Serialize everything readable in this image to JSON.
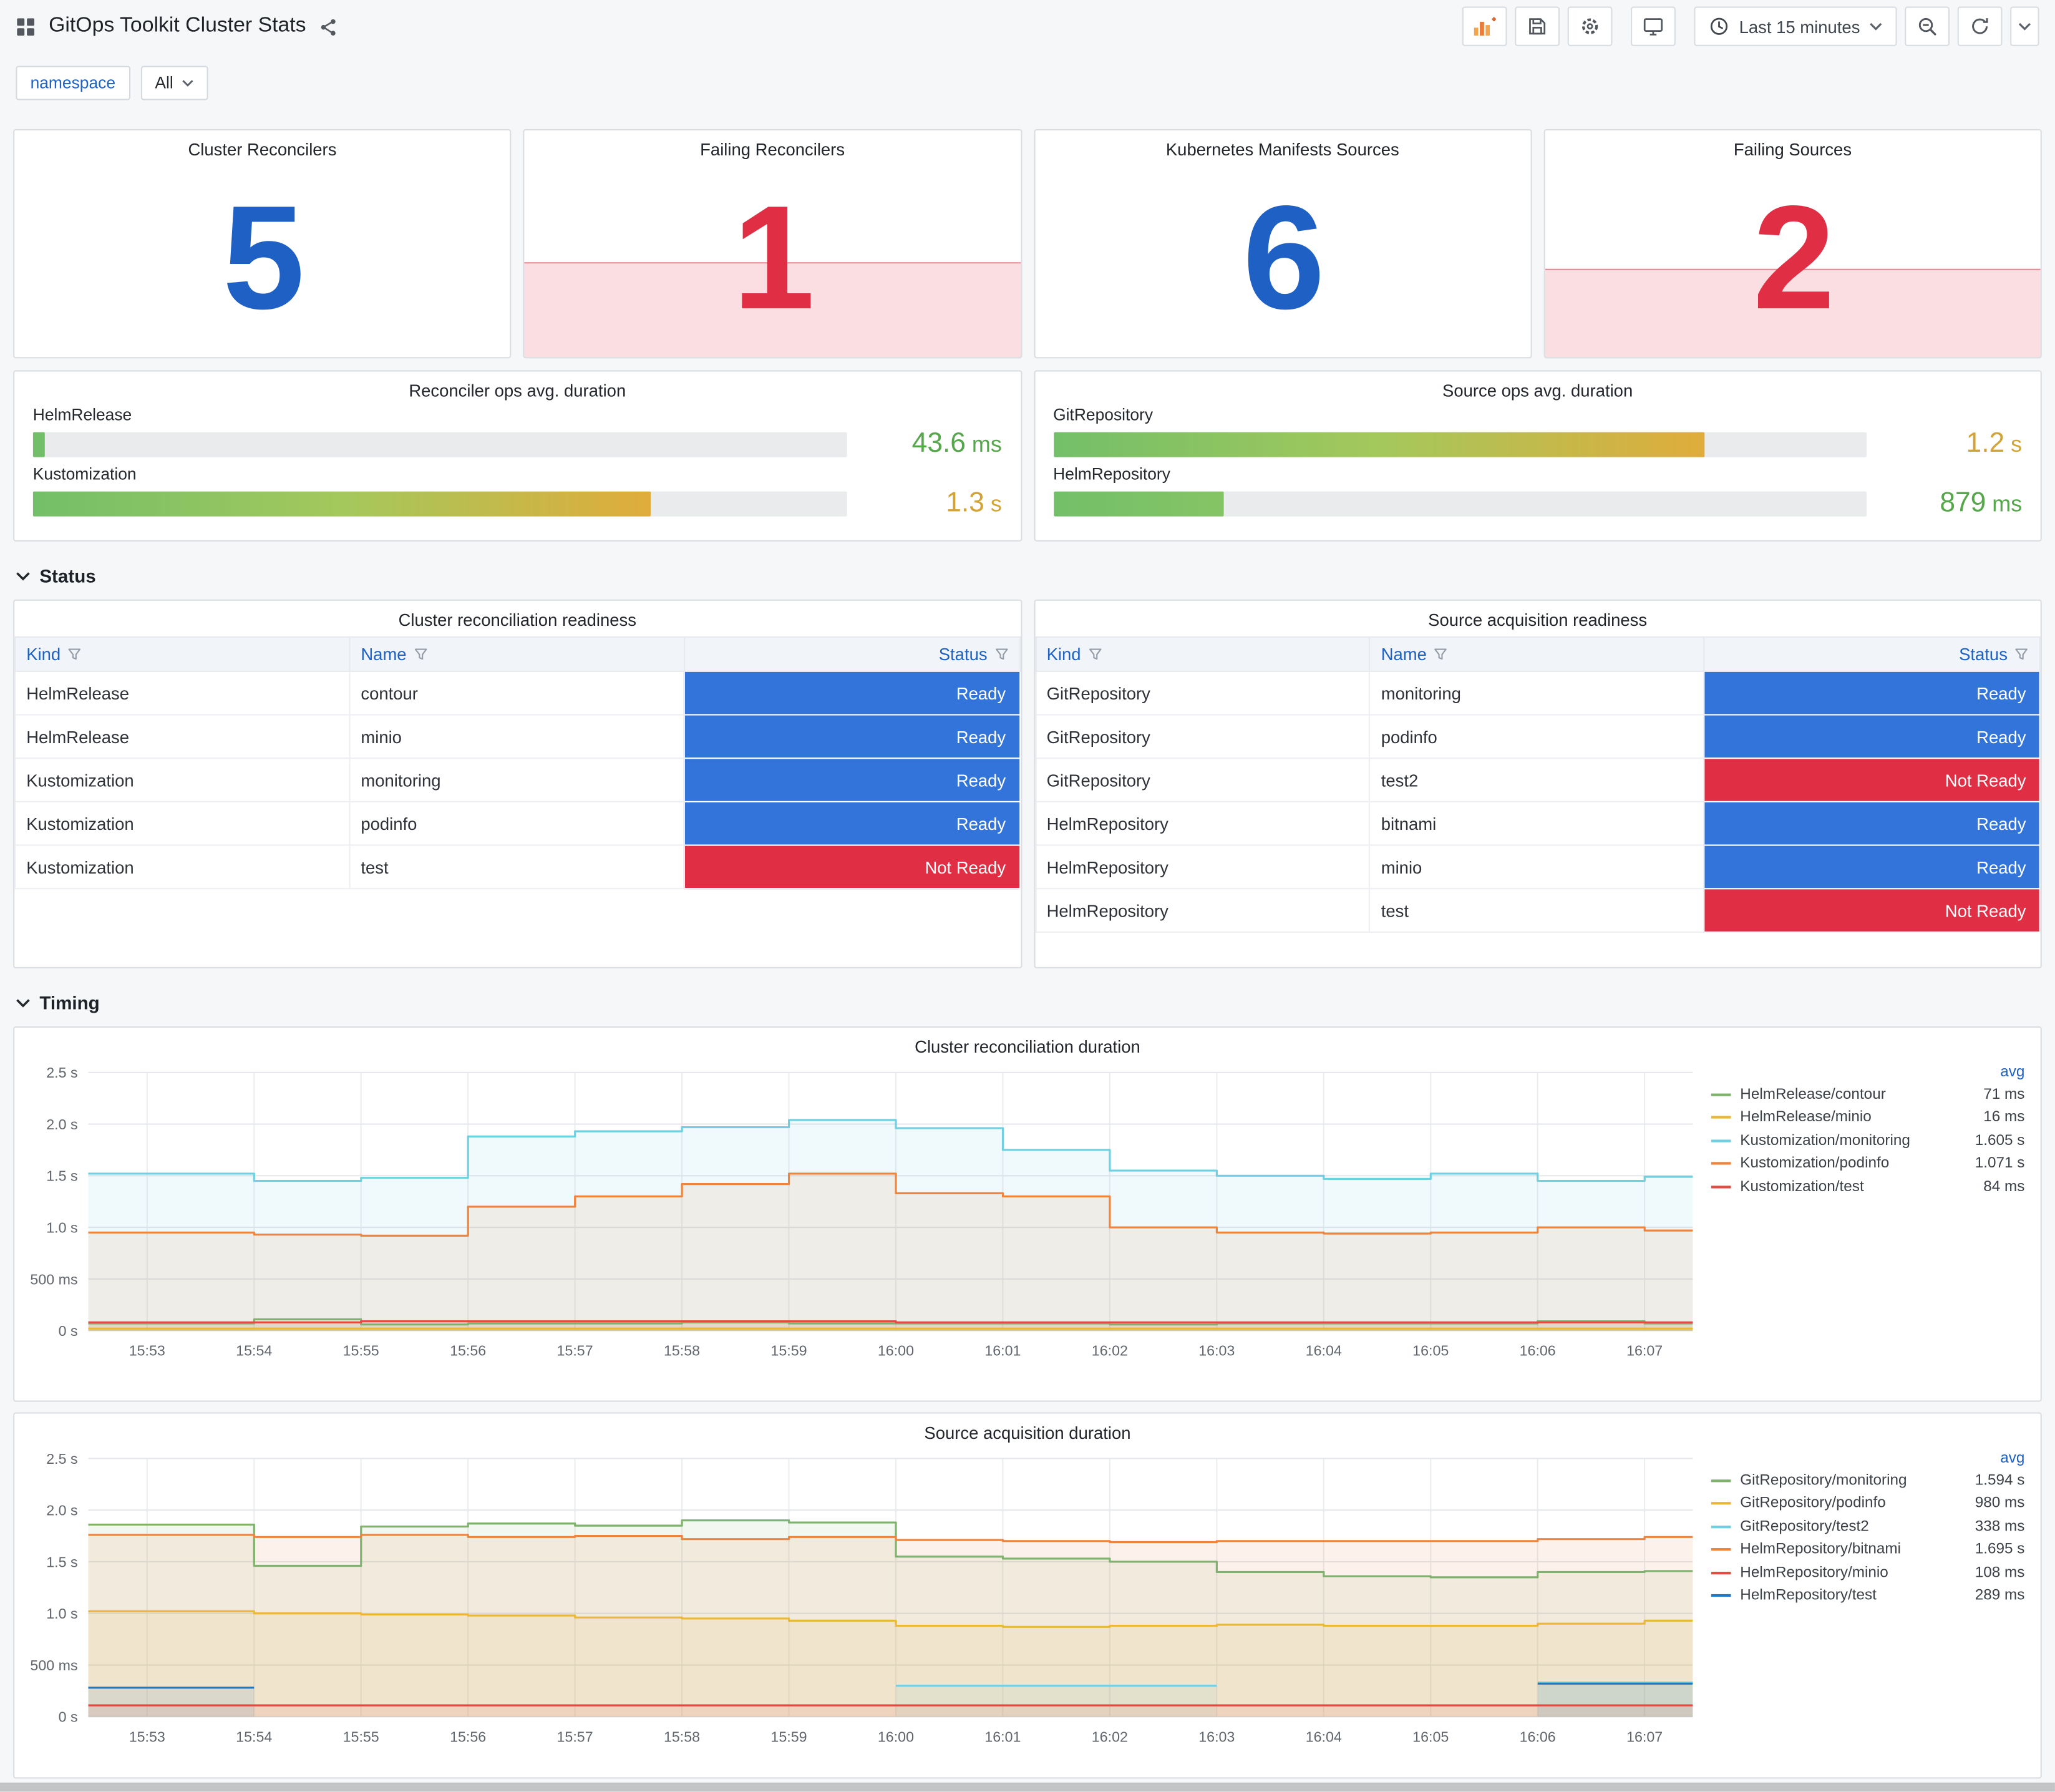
{
  "header": {
    "title": "GitOps Toolkit Cluster Stats",
    "time_range_label": "Last 15 minutes"
  },
  "filters": {
    "name_label": "namespace",
    "value_label": "All"
  },
  "sections": {
    "status": "Status",
    "timing": "Timing"
  },
  "colors": {
    "accent_blue": "#1F60C4",
    "accent_red": "#E02F44",
    "link_blue": "#1F62C4",
    "ready": "#3274D9",
    "not_ready": "#E02F44"
  },
  "stats": [
    {
      "title": "Cluster Reconcilers",
      "value": "5",
      "color": "#1F60C4"
    },
    {
      "title": "Failing Reconcilers",
      "value": "1",
      "color": "#E02F44",
      "band": true,
      "band_height_pct": 42,
      "band_fill": "rgba(224,47,68,0.16)",
      "band_line": "rgba(224,47,68,0.5)"
    },
    {
      "title": "Kubernetes Manifests Sources",
      "value": "6",
      "color": "#1F60C4"
    },
    {
      "title": "Failing Sources",
      "value": "2",
      "color": "#E02F44",
      "band": true,
      "band_height_pct": 39,
      "band_fill": "rgba(224,47,68,0.16)",
      "band_line": "rgba(224,47,68,0.5)"
    }
  ],
  "gauges": [
    {
      "title": "Reconciler ops avg. duration",
      "rows": [
        {
          "label": "HelmRelease",
          "value": "43.6",
          "unit": "ms",
          "value_color": "#56A64B",
          "fraction": 0.014,
          "fill": [
            "#73BF69",
            "#73BF69"
          ]
        },
        {
          "label": "Kustomization",
          "value": "1.3",
          "unit": "s",
          "value_color": "#D2A337",
          "fraction": 0.76,
          "fill": [
            "#73BF69",
            "#A4C85C",
            "#E0AC3B"
          ]
        }
      ]
    },
    {
      "title": "Source ops avg. duration",
      "rows": [
        {
          "label": "GitRepository",
          "value": "1.2",
          "unit": "s",
          "value_color": "#D2A337",
          "fraction": 0.8,
          "fill": [
            "#73BF69",
            "#A4C85C",
            "#E0AC3B"
          ]
        },
        {
          "label": "HelmRepository",
          "value": "879",
          "unit": "ms",
          "value_color": "#56A64B",
          "fraction": 0.21,
          "fill": [
            "#73BF69",
            "#85C465"
          ]
        }
      ]
    }
  ],
  "tables": [
    {
      "title": "Cluster reconciliation readiness",
      "columns": [
        "Kind",
        "Name",
        "Status"
      ],
      "rows": [
        {
          "kind": "HelmRelease",
          "name": "contour",
          "status": "Ready"
        },
        {
          "kind": "HelmRelease",
          "name": "minio",
          "status": "Ready"
        },
        {
          "kind": "Kustomization",
          "name": "monitoring",
          "status": "Ready"
        },
        {
          "kind": "Kustomization",
          "name": "podinfo",
          "status": "Ready"
        },
        {
          "kind": "Kustomization",
          "name": "test",
          "status": "Not Ready"
        }
      ]
    },
    {
      "title": "Source acquisition readiness",
      "columns": [
        "Kind",
        "Name",
        "Status"
      ],
      "rows": [
        {
          "kind": "GitRepository",
          "name": "monitoring",
          "status": "Ready"
        },
        {
          "kind": "GitRepository",
          "name": "podinfo",
          "status": "Ready"
        },
        {
          "kind": "GitRepository",
          "name": "test2",
          "status": "Not Ready"
        },
        {
          "kind": "HelmRepository",
          "name": "bitnami",
          "status": "Ready"
        },
        {
          "kind": "HelmRepository",
          "name": "minio",
          "status": "Ready"
        },
        {
          "kind": "HelmRepository",
          "name": "test",
          "status": "Not Ready"
        }
      ]
    }
  ],
  "chart_data": [
    {
      "type": "line",
      "title": "Cluster reconciliation duration",
      "x": [
        "15:53",
        "15:54",
        "15:55",
        "15:56",
        "15:57",
        "15:58",
        "15:59",
        "16:00",
        "16:01",
        "16:02",
        "16:03",
        "16:04",
        "16:05",
        "16:06",
        "16:07"
      ],
      "ylim": [
        0,
        2.5
      ],
      "yticks": [
        {
          "v": 0,
          "label": "0 s"
        },
        {
          "v": 0.5,
          "label": "500 ms"
        },
        {
          "v": 1,
          "label": "1.0 s"
        },
        {
          "v": 1.5,
          "label": "1.5 s"
        },
        {
          "v": 2,
          "label": "2.0 s"
        },
        {
          "v": 2.5,
          "label": "2.5 s"
        }
      ],
      "legend_header": "avg",
      "legend_position": "right",
      "grid": true,
      "series": [
        {
          "name": "HelmRelease/contour",
          "color": "#7EB26D",
          "avg": "71 ms",
          "values": [
            0.07,
            0.11,
            0.06,
            0.07,
            0.07,
            0.08,
            0.07,
            0.07,
            0.07,
            0.06,
            0.07,
            0.07,
            0.07,
            0.09,
            0.07
          ]
        },
        {
          "name": "HelmRelease/minio",
          "color": "#EAB839",
          "avg": "16 ms",
          "values": [
            0.02,
            0.02,
            0.02,
            0.02,
            0.02,
            0.02,
            0.02,
            0.02,
            0.02,
            0.02,
            0.02,
            0.02,
            0.02,
            0.02,
            0.02
          ]
        },
        {
          "name": "Kustomization/monitoring",
          "color": "#6ED0E0",
          "avg": "1.605 s",
          "values": [
            1.52,
            1.45,
            1.48,
            1.88,
            1.93,
            1.97,
            2.04,
            1.96,
            1.75,
            1.55,
            1.5,
            1.47,
            1.52,
            1.45,
            1.49
          ]
        },
        {
          "name": "Kustomization/podinfo",
          "color": "#EF843C",
          "avg": "1.071 s",
          "values": [
            0.95,
            0.93,
            0.92,
            1.2,
            1.3,
            1.42,
            1.52,
            1.33,
            1.3,
            1.0,
            0.95,
            0.94,
            0.95,
            1.0,
            0.97
          ]
        },
        {
          "name": "Kustomization/test",
          "color": "#E24D42",
          "avg": "84 ms",
          "values": [
            0.08,
            0.08,
            0.09,
            0.09,
            0.09,
            0.09,
            0.09,
            0.08,
            0.08,
            0.08,
            0.08,
            0.08,
            0.08,
            0.08,
            0.08
          ]
        }
      ]
    },
    {
      "type": "line",
      "title": "Source acquisition duration",
      "x": [
        "15:53",
        "15:54",
        "15:55",
        "15:56",
        "15:57",
        "15:58",
        "15:59",
        "16:00",
        "16:01",
        "16:02",
        "16:03",
        "16:04",
        "16:05",
        "16:06",
        "16:07"
      ],
      "ylim": [
        0,
        2.5
      ],
      "yticks": [
        {
          "v": 0,
          "label": "0 s"
        },
        {
          "v": 0.5,
          "label": "500 ms"
        },
        {
          "v": 1,
          "label": "1.0 s"
        },
        {
          "v": 1.5,
          "label": "1.5 s"
        },
        {
          "v": 2,
          "label": "2.0 s"
        },
        {
          "v": 2.5,
          "label": "2.5 s"
        }
      ],
      "legend_header": "avg",
      "legend_position": "right",
      "grid": true,
      "series": [
        {
          "name": "GitRepository/monitoring",
          "color": "#7EB26D",
          "avg": "1.594 s",
          "values": [
            1.86,
            1.46,
            1.84,
            1.87,
            1.85,
            1.9,
            1.88,
            1.55,
            1.53,
            1.5,
            1.4,
            1.36,
            1.35,
            1.4,
            1.41
          ]
        },
        {
          "name": "GitRepository/podinfo",
          "color": "#EAB839",
          "avg": "980 ms",
          "values": [
            1.02,
            1.0,
            0.99,
            0.98,
            0.96,
            0.95,
            0.93,
            0.88,
            0.87,
            0.88,
            0.89,
            0.88,
            0.88,
            0.9,
            0.93
          ]
        },
        {
          "name": "GitRepository/test2",
          "color": "#6ED0E0",
          "avg": "338 ms",
          "values": [
            null,
            null,
            null,
            null,
            null,
            null,
            null,
            0.3,
            0.3,
            0.3,
            0.3,
            null,
            null,
            0.33,
            0.33
          ]
        },
        {
          "name": "HelmRepository/bitnami",
          "color": "#EF843C",
          "avg": "1.695 s",
          "values": [
            1.76,
            1.74,
            1.76,
            1.74,
            1.75,
            1.72,
            1.74,
            1.71,
            1.7,
            1.69,
            1.7,
            1.7,
            1.7,
            1.72,
            1.74
          ]
        },
        {
          "name": "HelmRepository/minio",
          "color": "#E24D42",
          "avg": "108 ms",
          "values": [
            0.11,
            0.11,
            0.11,
            0.11,
            0.11,
            0.11,
            0.11,
            0.11,
            0.11,
            0.11,
            0.11,
            0.11,
            0.11,
            0.11,
            0.11
          ]
        },
        {
          "name": "HelmRepository/test",
          "color": "#1F78C1",
          "avg": "289 ms",
          "values": [
            0.28,
            0.28,
            null,
            null,
            null,
            null,
            null,
            null,
            null,
            null,
            null,
            null,
            null,
            0.32,
            0.32
          ]
        }
      ]
    }
  ]
}
